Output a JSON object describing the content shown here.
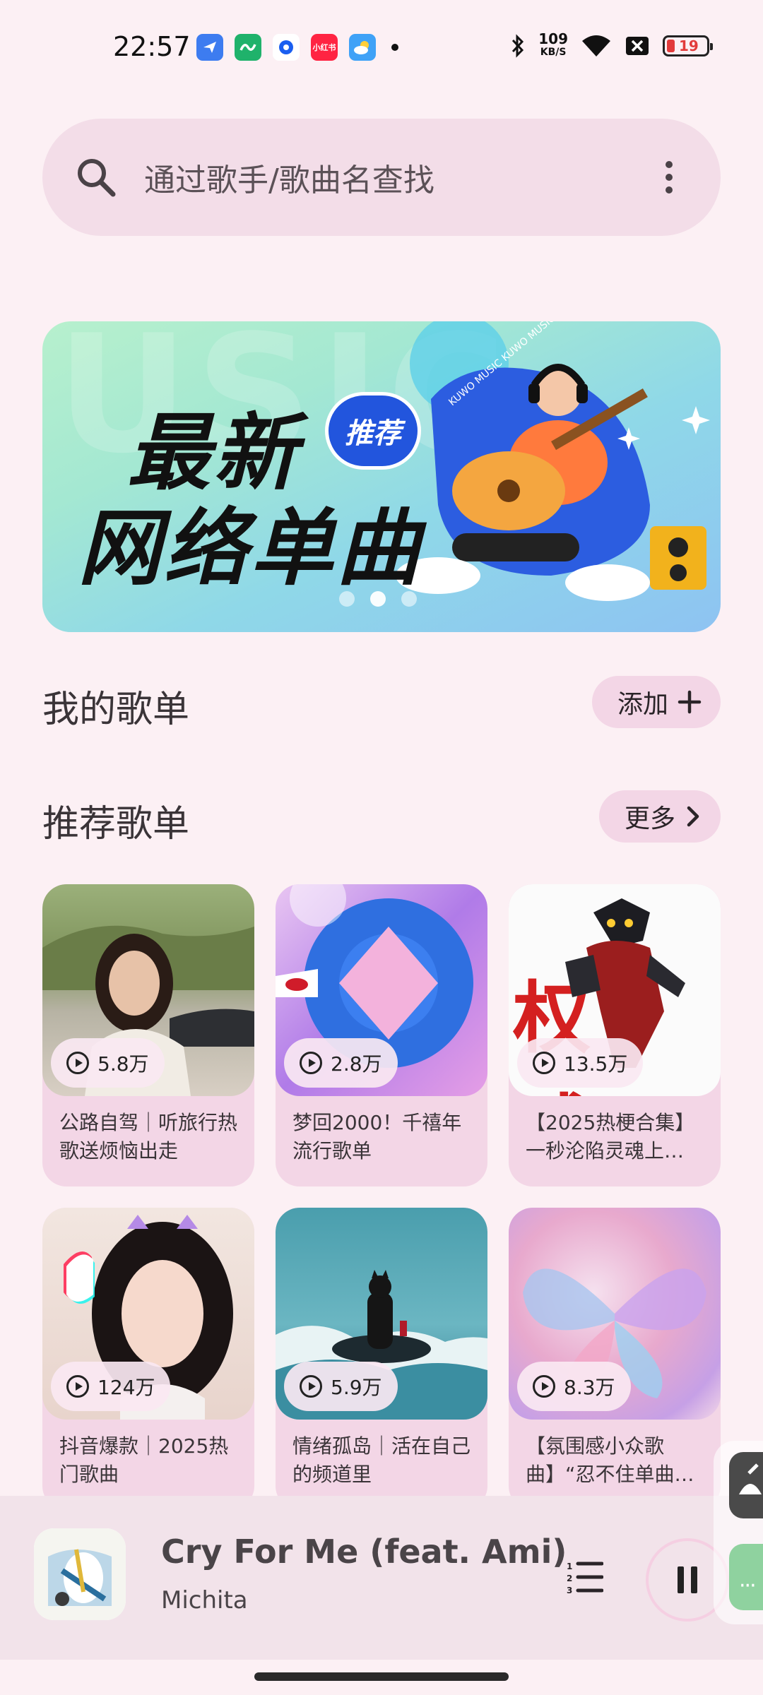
{
  "status_bar": {
    "time": "22:57",
    "net_speed": "109",
    "net_unit": "KB/S",
    "battery": "19",
    "notif_icons": [
      "feishu-icon",
      "app-green-icon",
      "app-blue-icon",
      "xiaohongshu-icon",
      "weather-icon"
    ],
    "notif_badge": "小红书"
  },
  "search": {
    "placeholder": "通过歌手/歌曲名查找"
  },
  "banner": {
    "line1": "最新",
    "line2": "网络单曲",
    "badge": "推荐",
    "brand_text": "KUWO MUSIC KUWO MUSIC",
    "bg_letters": "USIC",
    "active_slide": 2,
    "slide_count": 3
  },
  "my_playlists": {
    "title": "我的歌单",
    "add_label": "添加"
  },
  "recommended": {
    "title": "推荐歌单",
    "more_label": "更多",
    "cards": [
      {
        "count": "5.8万",
        "title": "公路自驾｜听旅行热歌送烦恼出走"
      },
      {
        "count": "2.8万",
        "title": "梦回2000！千禧年流行歌单"
      },
      {
        "count": "13.5万",
        "title": "【2025热梗合集】一秒沦陷灵魂上…",
        "cover_text": "权威"
      },
      {
        "count": "124万",
        "title": "抖音爆款｜2025热门歌曲"
      },
      {
        "count": "5.9万",
        "title": "情绪孤岛｜活在自己的频道里"
      },
      {
        "count": "8.3万",
        "title": "【氛围感小众歌曲】“忍不住单曲…"
      }
    ]
  },
  "player": {
    "title": "Cry For Me (feat. Ami)",
    "artist": "Michita"
  },
  "colors": {
    "background": "#fcf0f4",
    "card": "#f3d6e6",
    "search": "#f3dde8",
    "player": "#f2e3ea"
  }
}
